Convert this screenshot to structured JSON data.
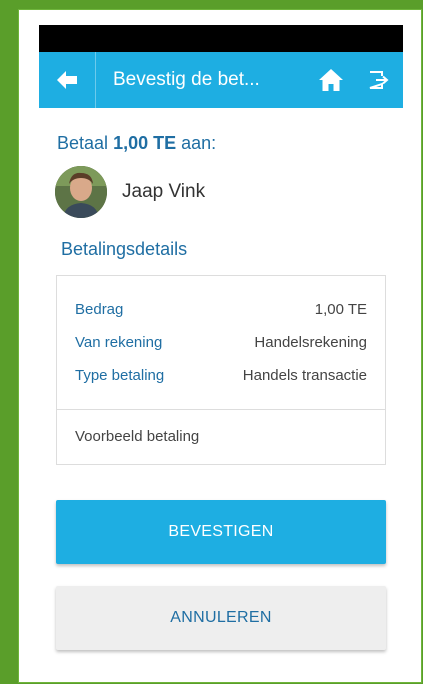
{
  "app_bar": {
    "title": "Bevestig de bet...",
    "background": "#1eaee2",
    "icons": [
      "arrow-left-icon",
      "home-icon",
      "logout-icon"
    ]
  },
  "payment": {
    "prefix": "Betaal",
    "amount": "1,00 TE",
    "suffix": "aan:"
  },
  "recipient": {
    "name": "Jaap Vink"
  },
  "details": {
    "section_title": "Betalingsdetails",
    "rows": [
      {
        "label": "Bedrag",
        "value": "1,00 TE"
      },
      {
        "label": "Van rekening",
        "value": "Handelsrekening"
      },
      {
        "label": "Type betaling",
        "value": "Handels transactie"
      }
    ],
    "note": "Voorbeeld betaling"
  },
  "buttons": {
    "confirm_label": "BEVESTIGEN",
    "cancel_label": "ANNULEREN"
  },
  "colors": {
    "accent": "#1eaee2",
    "label_blue": "#1f6ea3",
    "frame_green": "#5a9e2a"
  }
}
